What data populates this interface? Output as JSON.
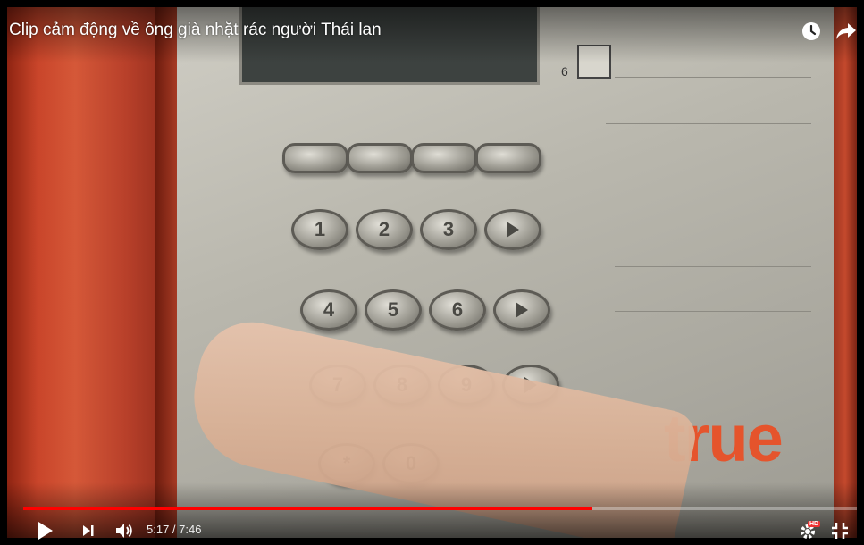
{
  "video": {
    "title": "Clip cảm động về ông già nhặt rác người Thái lan",
    "current_time": "5:17",
    "duration": "7:46",
    "time_display": "5:17 / 7:46",
    "progress": 0.683,
    "hd_label": "HD"
  },
  "scene": {
    "panel_number": "6",
    "logo": "true",
    "keypad": [
      "1",
      "2",
      "3",
      "4",
      "5",
      "6",
      "7",
      "8",
      "9",
      "*",
      "0"
    ]
  },
  "colors": {
    "progress": "#ff0000",
    "logo": "#e5542c",
    "housing": "#c9452a"
  },
  "icons": {
    "watch_later": "clock-icon",
    "share": "share-arrow-icon",
    "play": "play-icon",
    "next": "next-icon",
    "volume": "volume-icon",
    "settings": "gear-icon",
    "fullscreen": "exit-fullscreen-icon"
  }
}
